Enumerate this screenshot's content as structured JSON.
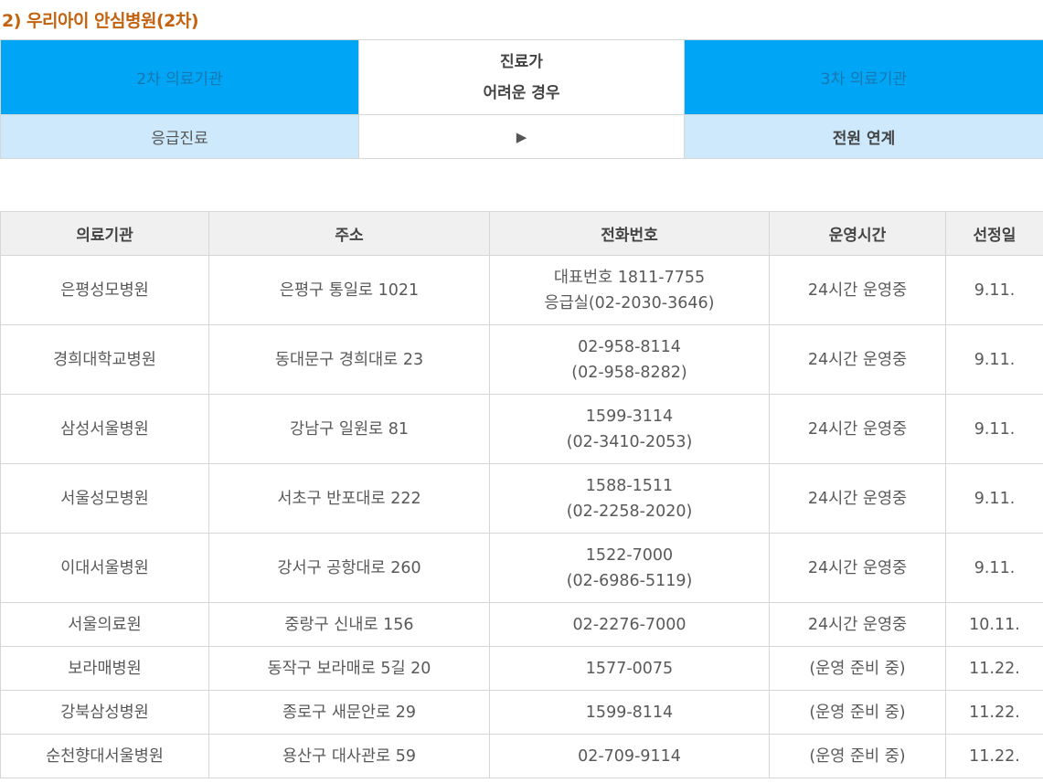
{
  "section_title": "2) 우리아이 안심병원(2차)",
  "flow": {
    "left_top": "2차 의료기관",
    "center_top_line1": "진료가",
    "center_top_line2": "어려운 경우",
    "right_top": "3차 의료기관",
    "left_bottom": "응급진료",
    "arrow": "▶",
    "right_bottom": "전원 연계"
  },
  "table": {
    "headers": [
      "의료기관",
      "주소",
      "전화번호",
      "운영시간",
      "선정일"
    ],
    "rows": [
      {
        "name": "은평성모병원",
        "address": "은평구 통일로 1021",
        "phone1": "대표번호 1811-7755",
        "phone2": "응급실(02-2030-3646)",
        "hours": "24시간 운영중",
        "date": "9.11."
      },
      {
        "name": "경희대학교병원",
        "address": "동대문구 경희대로 23",
        "phone1": "02-958-8114",
        "phone2": "(02-958-8282)",
        "hours": "24시간 운영중",
        "date": "9.11."
      },
      {
        "name": "삼성서울병원",
        "address": "강남구 일원로 81",
        "phone1": "1599-3114",
        "phone2": "(02-3410-2053)",
        "hours": "24시간 운영중",
        "date": "9.11."
      },
      {
        "name": "서울성모병원",
        "address": "서초구 반포대로 222",
        "phone1": "1588-1511",
        "phone2": "(02-2258-2020)",
        "hours": "24시간 운영중",
        "date": "9.11."
      },
      {
        "name": "이대서울병원",
        "address": "강서구 공항대로 260",
        "phone1": "1522-7000",
        "phone2": "(02-6986-5119)",
        "hours": "24시간 운영중",
        "date": "9.11."
      },
      {
        "name": "서울의료원",
        "address": "중랑구 신내로 156",
        "phone1": "02-2276-7000",
        "hours": "24시간 운영중",
        "date": "10.11."
      },
      {
        "name": "보라매병원",
        "address": "동작구 보라매로 5길 20",
        "phone1": "1577-0075",
        "hours": "(운영 준비 중)",
        "date": "11.22."
      },
      {
        "name": "강북삼성병원",
        "address": "종로구 새문안로 29",
        "phone1": "1599-8114",
        "hours": "(운영 준비 중)",
        "date": "11.22."
      },
      {
        "name": "순천향대서울병원",
        "address": "용산구 대사관로 59",
        "phone1": "02-709-9114",
        "hours": "(운영 준비 중)",
        "date": "11.22."
      }
    ]
  }
}
